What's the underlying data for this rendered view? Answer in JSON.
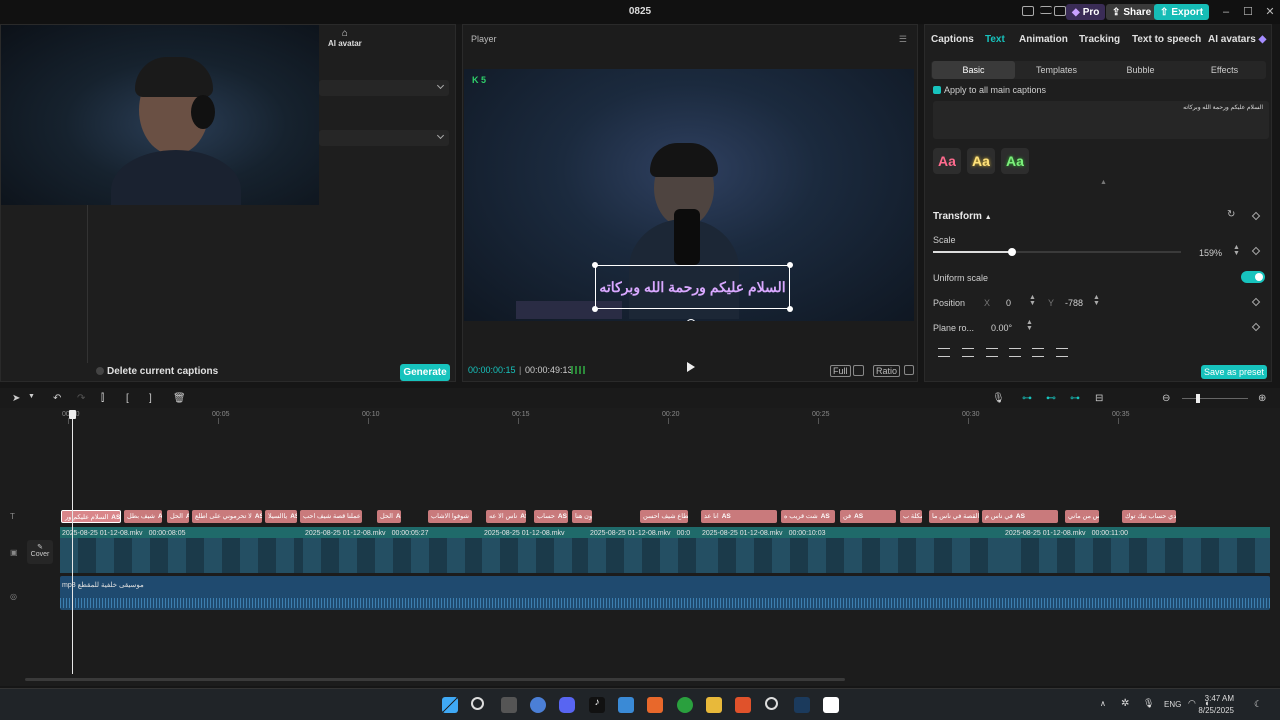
{
  "window": {
    "title": "0825"
  },
  "titlebar": {
    "pro_label": "Pro",
    "share_label": "Share",
    "export_label": "Export"
  },
  "left_panel": {
    "tab_ai_avatar": "AI avatar",
    "delete_captions_label": "Delete current captions",
    "generate_label": "Generate"
  },
  "player": {
    "title": "Player",
    "badge": "5",
    "caption_text": "السلام عليكم ورحمة الله وبركاته",
    "current_time": "00:00:00:15",
    "total_time": "00:00:49:13",
    "full_label": "Full",
    "ratio_label": "Ratio"
  },
  "right_panel": {
    "tabs": [
      "Captions",
      "Text",
      "Animation",
      "Tracking",
      "Text to speech",
      "AI avatars"
    ],
    "active_tab": "Text",
    "subtabs": [
      "Basic",
      "Templates",
      "Bubble",
      "Effects"
    ],
    "apply_all_label": "Apply to all main captions",
    "caption_text": "السلام عليكم ورحمة الله وبركاته",
    "style_sample": "Aa",
    "transform_label": "Transform",
    "scale_label": "Scale",
    "scale_value": "159%",
    "scale_fraction": 0.32,
    "uniform_scale_label": "Uniform scale",
    "position_label": "Position",
    "pos_x_label": "X",
    "pos_x_value": "0",
    "pos_y_label": "Y",
    "pos_y_value": "-788",
    "plane_label": "Plane ro...",
    "plane_value": "0.00°",
    "save_preset_label": "Save as preset"
  },
  "timeline": {
    "ruler": [
      "00:00",
      "00:05",
      "00:10",
      "00:15",
      "00:20",
      "00:25",
      "00:30",
      "00:35"
    ],
    "cover_label": "Cover",
    "caption_chips": [
      "السلام عليكم ور",
      "شيف بطل",
      "الحل",
      "لا تحرموني على اطلع",
      "ياالسيلا",
      "عملنا قصة شيف احب",
      "الحل",
      "شوفوا الاشاب",
      "ناس الا عه",
      "حساب",
      "شيرون هنا",
      "القطاع شيف احسن",
      "انا عد",
      "شت قريب ه",
      "فن",
      "شكلة ب",
      "القصة في ناس ما",
      "في ناس م",
      "في ناس من ماني",
      "انا عندي حساب تيك توك"
    ],
    "chip_tag": "AS",
    "video_clips": [
      {
        "name": "2025-08-25 01-12-08.mkv",
        "duration": "00:00:08:05"
      },
      {
        "name": "2025-08-25 01-12-08.mkv",
        "duration": "00:00:05:27"
      },
      {
        "name": "2025-08-25 01-12-08.mkv",
        "duration": ""
      },
      {
        "name": "2025-08-25 01-12-08.mkv",
        "duration": "00:0"
      },
      {
        "name": "2025-08-25 01-12-08.mkv",
        "duration": "00:00:10:03"
      },
      {
        "name": "2025-08-25 01-12-08.mkv",
        "duration": "00:00:11:00"
      }
    ],
    "audio_label": "mp3 موسيقى خلفية للمقطع"
  },
  "taskbar": {
    "lang": "ENG",
    "time": "3:47 AM",
    "date": "8/25/2025"
  }
}
